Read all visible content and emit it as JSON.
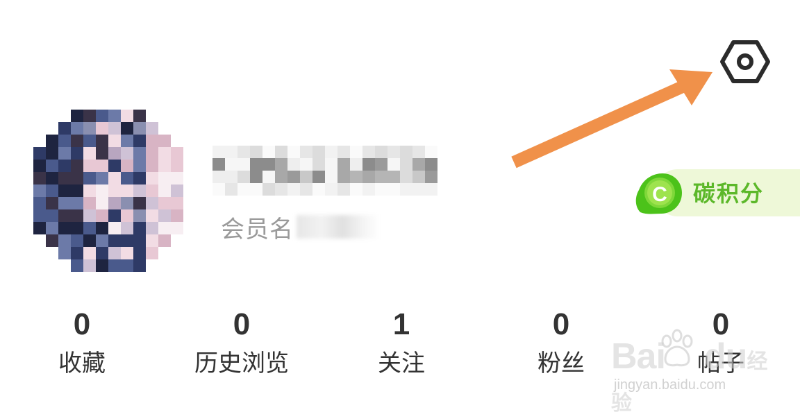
{
  "header": {
    "settings_icon": "hexagon-gear-icon"
  },
  "profile": {
    "member_label": "会员名",
    "username_obscured": true
  },
  "carbon_badge": {
    "coin_letter": "C",
    "label": "碳积分",
    "text_color": "#5cb82a",
    "bg_color": "#eef8d8",
    "coin_color": "#4cc21a"
  },
  "stats": [
    {
      "value": "0",
      "label": "收藏"
    },
    {
      "value": "0",
      "label": "历史浏览"
    },
    {
      "value": "1",
      "label": "关注"
    },
    {
      "value": "0",
      "label": "粉丝"
    },
    {
      "value": "0",
      "label": "帖子"
    }
  ],
  "annotation": {
    "arrow_color": "#f0914a"
  },
  "watermark": {
    "main": "Bai",
    "main_suffix": "du",
    "brand": "经验",
    "sub": "jingyan.baidu.com"
  }
}
